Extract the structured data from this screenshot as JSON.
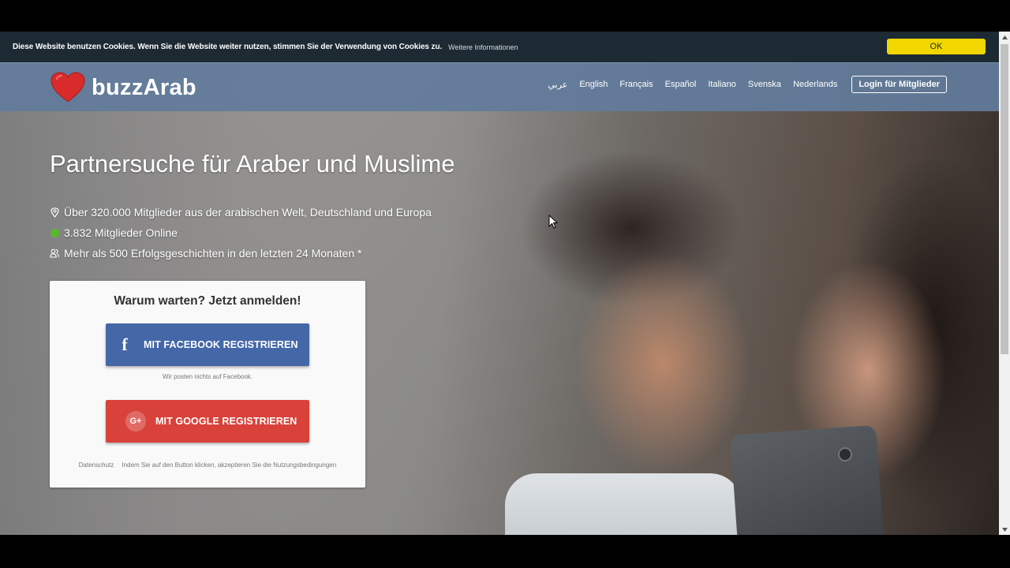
{
  "cookie": {
    "text": "Diese Website benutzen Cookies. Wenn Sie die Website weiter nutzen, stimmen Sie der Verwendung von Cookies zu.",
    "link": "Weitere Informationen",
    "ok": "OK"
  },
  "header": {
    "logo_text": "buzzArab",
    "languages": [
      "عربي",
      "English",
      "Français",
      "Español",
      "Italiano",
      "Svenska",
      "Nederlands"
    ],
    "login": "Login für Mitglieder"
  },
  "hero": {
    "title": "Partnersuche für Araber und Muslime",
    "facts": [
      {
        "icon": "location-pin-icon",
        "text": "Über 320.000 Mitglieder aus der arabischen Welt, Deutschland und Europa"
      },
      {
        "icon": "online-status-icon",
        "text": "3.832 Mitglieder Online"
      },
      {
        "icon": "users-icon",
        "text": "Mehr als 500 Erfolgsgeschichten in den letzten 24 Monaten *"
      }
    ]
  },
  "signup": {
    "title": "Warum warten? Jetzt anmelden!",
    "facebook_label": "MIT FACEBOOK REGISTRIEREN",
    "facebook_icon": "f",
    "facebook_note": "Wir posten nichts auf Facebook.",
    "google_label": "MIT GOOGLE REGISTRIEREN",
    "google_icon": "G+",
    "privacy": "Datenschutz",
    "terms": "Indem Sie auf den Button klicken, akzeptieren Sie die Nutzungsbedingungen"
  },
  "colors": {
    "cookie_bar": "#1d2a33",
    "cookie_ok": "#f1d600",
    "header": "#627c9c",
    "facebook": "#4467a8",
    "google": "#d8423b",
    "online": "#5ab82c",
    "logo_heart": "#d92b2b"
  }
}
